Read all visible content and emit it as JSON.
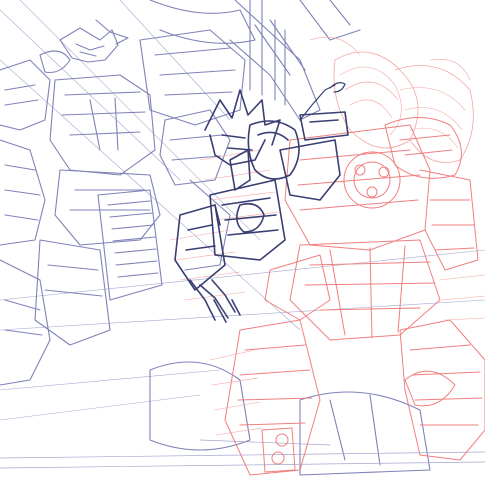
{
  "artwork": {
    "style": "rough digital sketch",
    "colors": {
      "background": "#ffffff",
      "foreground_lineart": "#3a3f73",
      "background_mech_lines": "#7f83b8",
      "background_mech_light": "#a4a7cf",
      "red_mech_lines": "#f07f7f",
      "red_mech_light": "#f4a4a0"
    }
  }
}
